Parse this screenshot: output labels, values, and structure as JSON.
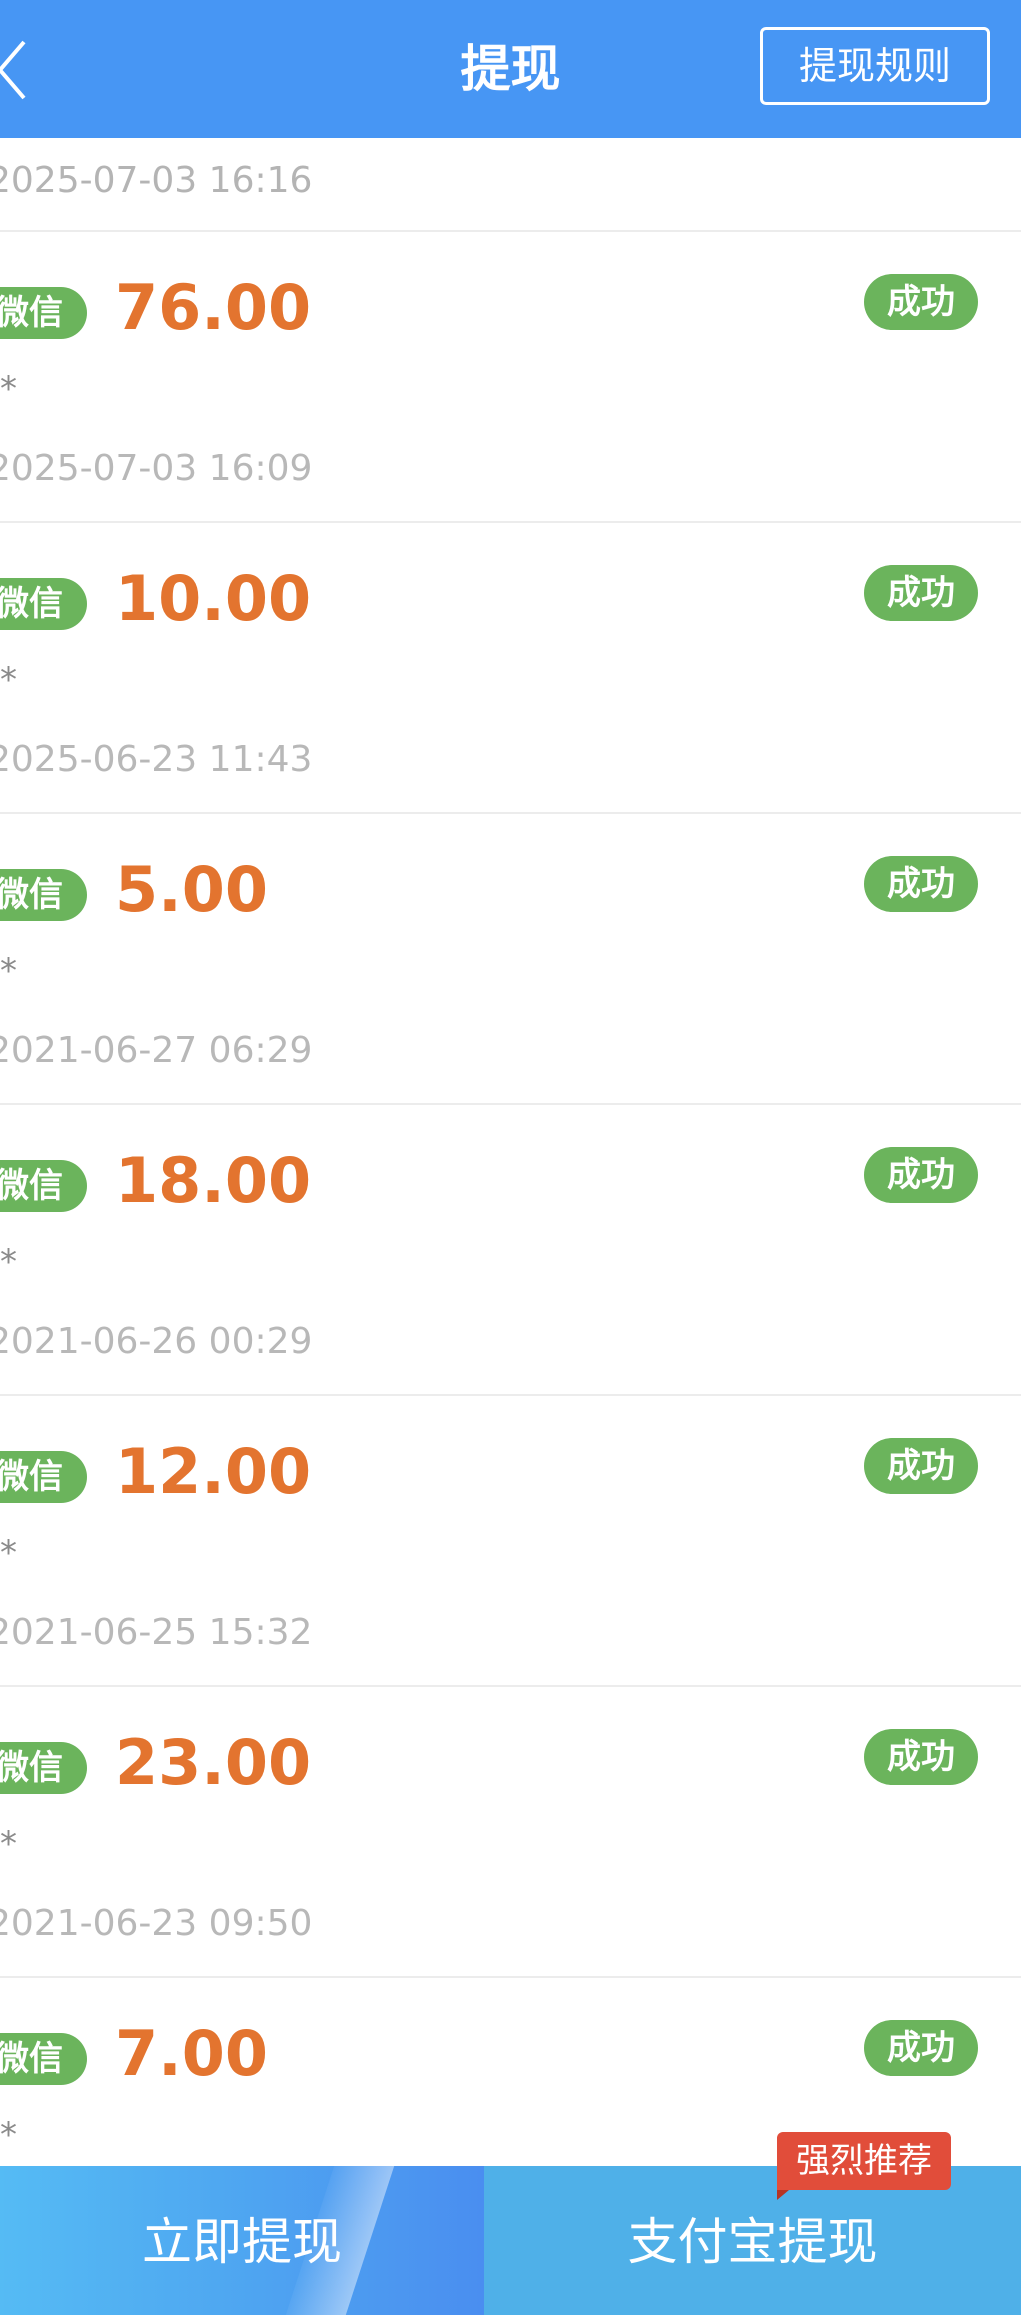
{
  "header": {
    "title": "提现",
    "rules_label": "提现规则"
  },
  "top_partial": {
    "date": "2025-07-03 16:16"
  },
  "records": [
    {
      "channel": "微信",
      "amount": "76.00",
      "status": "成功",
      "name": "J*",
      "date": "2025-07-03 16:09"
    },
    {
      "channel": "微信",
      "amount": "10.00",
      "status": "成功",
      "name": "J*",
      "date": "2025-06-23 11:43"
    },
    {
      "channel": "微信",
      "amount": "5.00",
      "status": "成功",
      "name": "J*",
      "date": "2021-06-27 06:29"
    },
    {
      "channel": "微信",
      "amount": "18.00",
      "status": "成功",
      "name": "J*",
      "date": "2021-06-26 00:29"
    },
    {
      "channel": "微信",
      "amount": "12.00",
      "status": "成功",
      "name": "J*",
      "date": "2021-06-25 15:32"
    },
    {
      "channel": "微信",
      "amount": "23.00",
      "status": "成功",
      "name": "J*",
      "date": "2021-06-23 09:50"
    },
    {
      "channel": "微信",
      "amount": "7.00",
      "status": "成功",
      "name": "J*",
      "date": ""
    }
  ],
  "bottom": {
    "withdraw_now": "立即提现",
    "alipay_withdraw": "支付宝提现",
    "recommend_badge": "强烈推荐"
  },
  "colors": {
    "header_bg": "#4796f4",
    "amount": "#e3742f",
    "status_green": "#6bb45c",
    "badge_red": "#e14d3a"
  }
}
